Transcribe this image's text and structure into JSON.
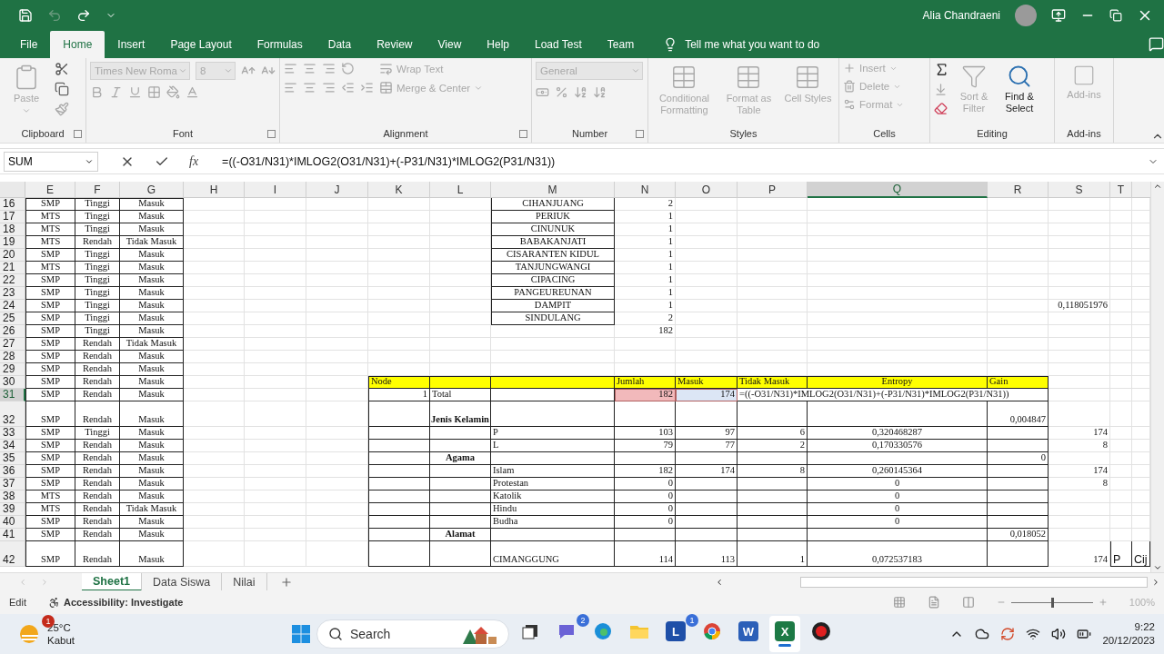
{
  "title_bar": {
    "user": "Alia Chandraeni"
  },
  "menu_tabs": [
    {
      "label": "File",
      "selected": false
    },
    {
      "label": "Home",
      "selected": true
    },
    {
      "label": "Insert",
      "selected": false
    },
    {
      "label": "Page Layout",
      "selected": false
    },
    {
      "label": "Formulas",
      "selected": false
    },
    {
      "label": "Data",
      "selected": false
    },
    {
      "label": "Review",
      "selected": false
    },
    {
      "label": "View",
      "selected": false
    },
    {
      "label": "Help",
      "selected": false
    },
    {
      "label": "Load Test",
      "selected": false
    },
    {
      "label": "Team",
      "selected": false
    }
  ],
  "tell_me": "Tell me what you want to do",
  "ribbon": {
    "groups": [
      {
        "kind": "clipboard",
        "label": "Clipboard",
        "buttons": [
          {
            "label": "Paste",
            "disabled": true
          }
        ]
      },
      {
        "kind": "font",
        "label": "Font",
        "font_name": "Times New Roma",
        "font_size": "8"
      },
      {
        "kind": "alignment",
        "label": "Alignment",
        "buttons": [
          {
            "label": "Wrap Text",
            "disabled": true
          },
          {
            "label": "Merge & Center",
            "disabled": true
          }
        ]
      },
      {
        "kind": "number",
        "label": "Number",
        "format": "General"
      },
      {
        "kind": "styles",
        "label": "Styles",
        "buttons": [
          {
            "label": "Conditional Formatting",
            "disabled": true
          },
          {
            "label": "Format as Table",
            "disabled": true
          },
          {
            "label": "Cell Styles",
            "disabled": true
          }
        ]
      },
      {
        "kind": "cells",
        "label": "Cells",
        "buttons": [
          {
            "label": "Insert",
            "disabled": true
          },
          {
            "label": "Delete",
            "disabled": true
          },
          {
            "label": "Format",
            "disabled": true
          }
        ]
      },
      {
        "kind": "editing",
        "label": "Editing",
        "buttons": [
          {
            "label": "Sort & Filter",
            "disabled": true
          },
          {
            "label": "Find & Select",
            "disabled": false
          }
        ]
      },
      {
        "kind": "addins",
        "label": "Add-ins",
        "buttons": [
          {
            "label": "Add-ins",
            "disabled": true
          }
        ]
      }
    ]
  },
  "formula_bar": {
    "name_box": "SUM",
    "fx": "fx",
    "formula": "=((-O31/N31)*IMLOG2(O31/N31)+(-P31/N31)*IMLOG2(P31/N31))"
  },
  "sheet": {
    "columns": [
      {
        "label": "E",
        "selected": false
      },
      {
        "label": "F",
        "selected": false
      },
      {
        "label": "G",
        "selected": false
      },
      {
        "label": "H",
        "selected": false
      },
      {
        "label": "I",
        "selected": false
      },
      {
        "label": "J",
        "selected": false
      },
      {
        "label": "K",
        "selected": false
      },
      {
        "label": "L",
        "selected": false
      },
      {
        "label": "M",
        "selected": false
      },
      {
        "label": "N",
        "selected": false
      },
      {
        "label": "O",
        "selected": false
      },
      {
        "label": "P",
        "selected": false
      },
      {
        "label": "Q",
        "selected": true
      },
      {
        "label": "R",
        "selected": false
      },
      {
        "label": "S",
        "selected": false
      },
      {
        "label": "T",
        "selected": false
      }
    ],
    "rows": [
      {
        "label": "16",
        "kind": "normal",
        "selected": false,
        "cells": {
          "E": {
            "text": "SMP",
            "kind": "center"
          },
          "F": {
            "text": "Tinggi",
            "kind": "center"
          },
          "G": {
            "text": "Masuk",
            "kind": "center"
          },
          "M": {
            "text": "CIHANJUANG",
            "kind": "center"
          },
          "N": {
            "text": "2",
            "kind": "right"
          }
        }
      },
      {
        "label": "17",
        "kind": "normal",
        "selected": false,
        "cells": {
          "E": {
            "text": "MTS",
            "kind": "center"
          },
          "F": {
            "text": "Tinggi",
            "kind": "center"
          },
          "G": {
            "text": "Masuk",
            "kind": "center"
          },
          "M": {
            "text": "PERIUK",
            "kind": "center"
          },
          "N": {
            "text": "1",
            "kind": "right"
          }
        }
      },
      {
        "label": "18",
        "kind": "normal",
        "selected": false,
        "cells": {
          "E": {
            "text": "MTS",
            "kind": "center"
          },
          "F": {
            "text": "Tinggi",
            "kind": "center"
          },
          "G": {
            "text": "Masuk",
            "kind": "center"
          },
          "M": {
            "text": "CINUNUK",
            "kind": "center"
          },
          "N": {
            "text": "1",
            "kind": "right"
          }
        }
      },
      {
        "label": "19",
        "kind": "normal",
        "selected": false,
        "cells": {
          "E": {
            "text": "MTS",
            "kind": "center"
          },
          "F": {
            "text": "Rendah",
            "kind": "center"
          },
          "G": {
            "text": "Tidak Masuk",
            "kind": "center"
          },
          "M": {
            "text": "BABAKANJATI",
            "kind": "center"
          },
          "N": {
            "text": "1",
            "kind": "right"
          }
        }
      },
      {
        "label": "20",
        "kind": "normal",
        "selected": false,
        "cells": {
          "E": {
            "text": "SMP",
            "kind": "center"
          },
          "F": {
            "text": "Tinggi",
            "kind": "center"
          },
          "G": {
            "text": "Masuk",
            "kind": "center"
          },
          "M": {
            "text": "CISARANTEN KIDUL",
            "kind": "center"
          },
          "N": {
            "text": "1",
            "kind": "right"
          }
        }
      },
      {
        "label": "21",
        "kind": "normal",
        "selected": false,
        "cells": {
          "E": {
            "text": "MTS",
            "kind": "center"
          },
          "F": {
            "text": "Tinggi",
            "kind": "center"
          },
          "G": {
            "text": "Masuk",
            "kind": "center"
          },
          "M": {
            "text": "TANJUNGWANGI",
            "kind": "center"
          },
          "N": {
            "text": "1",
            "kind": "right"
          }
        }
      },
      {
        "label": "22",
        "kind": "normal",
        "selected": false,
        "cells": {
          "E": {
            "text": "SMP",
            "kind": "center"
          },
          "F": {
            "text": "Tinggi",
            "kind": "center"
          },
          "G": {
            "text": "Masuk",
            "kind": "center"
          },
          "M": {
            "text": "CIPACING",
            "kind": "center"
          },
          "N": {
            "text": "1",
            "kind": "right"
          }
        }
      },
      {
        "label": "23",
        "kind": "normal",
        "selected": false,
        "cells": {
          "E": {
            "text": "SMP",
            "kind": "center"
          },
          "F": {
            "text": "Tinggi",
            "kind": "center"
          },
          "G": {
            "text": "Masuk",
            "kind": "center"
          },
          "M": {
            "text": "PANGEUREUNAN",
            "kind": "center"
          },
          "N": {
            "text": "1",
            "kind": "right"
          }
        }
      },
      {
        "label": "24",
        "kind": "normal",
        "selected": false,
        "cells": {
          "E": {
            "text": "SMP",
            "kind": "center"
          },
          "F": {
            "text": "Tinggi",
            "kind": "center"
          },
          "G": {
            "text": "Masuk",
            "kind": "center"
          },
          "M": {
            "text": "DAMPIT",
            "kind": "center"
          },
          "N": {
            "text": "1",
            "kind": "right"
          },
          "S": {
            "text": "0,118051976",
            "kind": "right"
          }
        }
      },
      {
        "label": "25",
        "kind": "normal",
        "selected": false,
        "cells": {
          "E": {
            "text": "SMP",
            "kind": "center"
          },
          "F": {
            "text": "Tinggi",
            "kind": "center"
          },
          "G": {
            "text": "Masuk",
            "kind": "center"
          },
          "M": {
            "text": "SINDULANG",
            "kind": "center"
          },
          "N": {
            "text": "2",
            "kind": "right"
          }
        }
      },
      {
        "label": "26",
        "kind": "normal",
        "selected": false,
        "cells": {
          "E": {
            "text": "SMP",
            "kind": "center"
          },
          "F": {
            "text": "Tinggi",
            "kind": "center"
          },
          "G": {
            "text": "Masuk",
            "kind": "center"
          },
          "N": {
            "text": "182",
            "kind": "right"
          }
        }
      },
      {
        "label": "27",
        "kind": "normal",
        "selected": false,
        "cells": {
          "E": {
            "text": "SMP",
            "kind": "center"
          },
          "F": {
            "text": "Rendah",
            "kind": "center"
          },
          "G": {
            "text": "Tidak Masuk",
            "kind": "center"
          }
        }
      },
      {
        "label": "28",
        "kind": "normal",
        "selected": false,
        "cells": {
          "E": {
            "text": "SMP",
            "kind": "center"
          },
          "F": {
            "text": "Rendah",
            "kind": "center"
          },
          "G": {
            "text": "Masuk",
            "kind": "center"
          }
        }
      },
      {
        "label": "29",
        "kind": "normal",
        "selected": false,
        "cells": {
          "E": {
            "text": "SMP",
            "kind": "center"
          },
          "F": {
            "text": "Rendah",
            "kind": "center"
          },
          "G": {
            "text": "Masuk",
            "kind": "center"
          }
        }
      },
      {
        "label": "30",
        "kind": "header",
        "selected": false,
        "cells": {
          "E": {
            "text": "SMP",
            "kind": "center"
          },
          "F": {
            "text": "Rendah",
            "kind": "center"
          },
          "G": {
            "text": "Masuk",
            "kind": "center"
          },
          "K": {
            "text": "Node",
            "kind": "left"
          },
          "N": {
            "text": "Jumlah",
            "kind": "left"
          },
          "O": {
            "text": "Masuk",
            "kind": "left"
          },
          "P": {
            "text": "Tidak Masuk",
            "kind": "left"
          },
          "Q": {
            "text": "Entropy",
            "kind": "center"
          },
          "R": {
            "text": "Gain",
            "kind": "left"
          }
        }
      },
      {
        "label": "31",
        "kind": "normal",
        "selected": true,
        "cells": {
          "E": {
            "text": "SMP",
            "kind": "center"
          },
          "F": {
            "text": "Rendah",
            "kind": "center"
          },
          "G": {
            "text": "Masuk",
            "kind": "center"
          },
          "K": {
            "text": "1",
            "kind": "right"
          },
          "L": {
            "text": "Total",
            "kind": "left"
          },
          "N": {
            "text": "182",
            "kind": "right",
            "color": "#f2b9bb"
          },
          "O": {
            "text": "174",
            "kind": "right",
            "color": "#dce6f5"
          },
          "P": {
            "kind": "formula",
            "text": "=((-O31/N31)*IMLOG2(O31/N31)+(-P31/N31)*IMLOG2(P31/N31))"
          }
        }
      },
      {
        "label": "32",
        "kind": "tall",
        "selected": false,
        "cells": {
          "E": {
            "text": "SMP",
            "kind": "center"
          },
          "F": {
            "text": "Rendah",
            "kind": "center"
          },
          "G": {
            "text": "Masuk",
            "kind": "center"
          },
          "L": {
            "text": "Jenis Kelamin",
            "kind": "bold"
          },
          "R": {
            "text": "0,004847",
            "kind": "right"
          }
        }
      },
      {
        "label": "33",
        "kind": "normal",
        "selected": false,
        "cells": {
          "E": {
            "text": "SMP",
            "kind": "center"
          },
          "F": {
            "text": "Tinggi",
            "kind": "center"
          },
          "G": {
            "text": "Masuk",
            "kind": "center"
          },
          "M": {
            "text": "P",
            "kind": "left"
          },
          "N": {
            "text": "103",
            "kind": "right"
          },
          "O": {
            "text": "97",
            "kind": "right"
          },
          "P": {
            "text": "6",
            "kind": "right"
          },
          "Q": {
            "text": "0,320468287",
            "kind": "center"
          },
          "S": {
            "text": "174",
            "kind": "right"
          }
        }
      },
      {
        "label": "34",
        "kind": "normal",
        "selected": false,
        "cells": {
          "E": {
            "text": "SMP",
            "kind": "center"
          },
          "F": {
            "text": "Rendah",
            "kind": "center"
          },
          "G": {
            "text": "Masuk",
            "kind": "center"
          },
          "M": {
            "text": "L",
            "kind": "left"
          },
          "N": {
            "text": "79",
            "kind": "right"
          },
          "O": {
            "text": "77",
            "kind": "right"
          },
          "P": {
            "text": "2",
            "kind": "right"
          },
          "Q": {
            "text": "0,170330576",
            "kind": "center"
          },
          "S": {
            "text": "8",
            "kind": "right"
          }
        }
      },
      {
        "label": "35",
        "kind": "normal",
        "selected": false,
        "cells": {
          "E": {
            "text": "SMP",
            "kind": "center"
          },
          "F": {
            "text": "Rendah",
            "kind": "center"
          },
          "G": {
            "text": "Masuk",
            "kind": "center"
          },
          "L": {
            "text": "Agama",
            "kind": "bold"
          },
          "R": {
            "text": "0",
            "kind": "right"
          }
        }
      },
      {
        "label": "36",
        "kind": "normal",
        "selected": false,
        "cells": {
          "E": {
            "text": "SMP",
            "kind": "center"
          },
          "F": {
            "text": "Rendah",
            "kind": "center"
          },
          "G": {
            "text": "Masuk",
            "kind": "center"
          },
          "M": {
            "text": "Islam",
            "kind": "left"
          },
          "N": {
            "text": "182",
            "kind": "right"
          },
          "O": {
            "text": "174",
            "kind": "right"
          },
          "P": {
            "text": "8",
            "kind": "right"
          },
          "Q": {
            "text": "0,260145364",
            "kind": "center"
          },
          "S": {
            "text": "174",
            "kind": "right"
          }
        }
      },
      {
        "label": "37",
        "kind": "normal",
        "selected": false,
        "cells": {
          "E": {
            "text": "SMP",
            "kind": "center"
          },
          "F": {
            "text": "Rendah",
            "kind": "center"
          },
          "G": {
            "text": "Masuk",
            "kind": "center"
          },
          "M": {
            "text": "Protestan",
            "kind": "left"
          },
          "N": {
            "text": "0",
            "kind": "right"
          },
          "Q": {
            "text": "0",
            "kind": "center"
          },
          "S": {
            "text": "8",
            "kind": "right"
          }
        }
      },
      {
        "label": "38",
        "kind": "normal",
        "selected": false,
        "cells": {
          "E": {
            "text": "MTS",
            "kind": "center"
          },
          "F": {
            "text": "Rendah",
            "kind": "center"
          },
          "G": {
            "text": "Masuk",
            "kind": "center"
          },
          "M": {
            "text": "Katolik",
            "kind": "left"
          },
          "N": {
            "text": "0",
            "kind": "right"
          },
          "Q": {
            "text": "0",
            "kind": "center"
          }
        }
      },
      {
        "label": "39",
        "kind": "normal",
        "selected": false,
        "cells": {
          "E": {
            "text": "MTS",
            "kind": "center"
          },
          "F": {
            "text": "Rendah",
            "kind": "center"
          },
          "G": {
            "text": "Tidak Masuk",
            "kind": "center"
          },
          "M": {
            "text": "Hindu",
            "kind": "left"
          },
          "N": {
            "text": "0",
            "kind": "right"
          },
          "Q": {
            "text": "0",
            "kind": "center"
          }
        }
      },
      {
        "label": "40",
        "kind": "normal",
        "selected": false,
        "cells": {
          "E": {
            "text": "SMP",
            "kind": "center"
          },
          "F": {
            "text": "Rendah",
            "kind": "center"
          },
          "G": {
            "text": "Masuk",
            "kind": "center"
          },
          "M": {
            "text": "Budha",
            "kind": "left"
          },
          "N": {
            "text": "0",
            "kind": "right"
          },
          "Q": {
            "text": "0",
            "kind": "center"
          }
        }
      },
      {
        "label": "41",
        "kind": "normal",
        "selected": false,
        "cells": {
          "E": {
            "text": "SMP",
            "kind": "center"
          },
          "F": {
            "text": "Rendah",
            "kind": "center"
          },
          "G": {
            "text": "Masuk",
            "kind": "center"
          },
          "L": {
            "text": "Alamat",
            "kind": "bold"
          },
          "R": {
            "text": "0,018052",
            "kind": "right"
          }
        }
      },
      {
        "label": "42",
        "kind": "tall",
        "selected": false,
        "cells": {
          "E": {
            "text": "SMP",
            "kind": "center"
          },
          "F": {
            "text": "Rendah",
            "kind": "center"
          },
          "G": {
            "text": "Masuk",
            "kind": "center"
          },
          "M": {
            "text": "CIMANGGUNG",
            "kind": "left"
          },
          "N": {
            "text": "114",
            "kind": "right"
          },
          "O": {
            "text": "113",
            "kind": "right"
          },
          "P": {
            "text": "1",
            "kind": "right"
          },
          "Q": {
            "text": "0,072537183",
            "kind": "center"
          },
          "S": {
            "text": "174",
            "kind": "right"
          },
          "T": {
            "text": "P",
            "kind": "sans"
          },
          "U": {
            "text": "Cij",
            "kind": "sans"
          }
        }
      }
    ]
  },
  "sheet_tabs": [
    {
      "label": "Sheet1",
      "selected": true
    },
    {
      "label": "Data Siswa",
      "selected": false
    },
    {
      "label": "Nilai",
      "selected": false
    }
  ],
  "status_bar": {
    "mode": "Edit",
    "accessibility": "Accessibility: Investigate",
    "zoom_slider": {
      "level": 0.5
    },
    "zoom": "100%"
  },
  "taskbar": {
    "weather": {
      "temperature": "25°C",
      "condition": "Kabut",
      "badge": "1"
    },
    "search": "Search",
    "apps": [
      {
        "kind": "taskview",
        "selected": false
      },
      {
        "kind": "chat",
        "badge": "2",
        "selected": false
      },
      {
        "kind": "edge",
        "selected": false
      },
      {
        "kind": "explorer",
        "selected": false
      },
      {
        "kind": "letter",
        "glyph": "L",
        "badge": "1",
        "selected": false
      },
      {
        "kind": "chrome",
        "selected": false
      },
      {
        "kind": "word",
        "glyph": "W",
        "selected": false
      },
      {
        "kind": "excel",
        "glyph": "X",
        "selected": true
      },
      {
        "kind": "record",
        "selected": false
      }
    ],
    "time": "9:22",
    "date": "20/12/2023"
  }
}
